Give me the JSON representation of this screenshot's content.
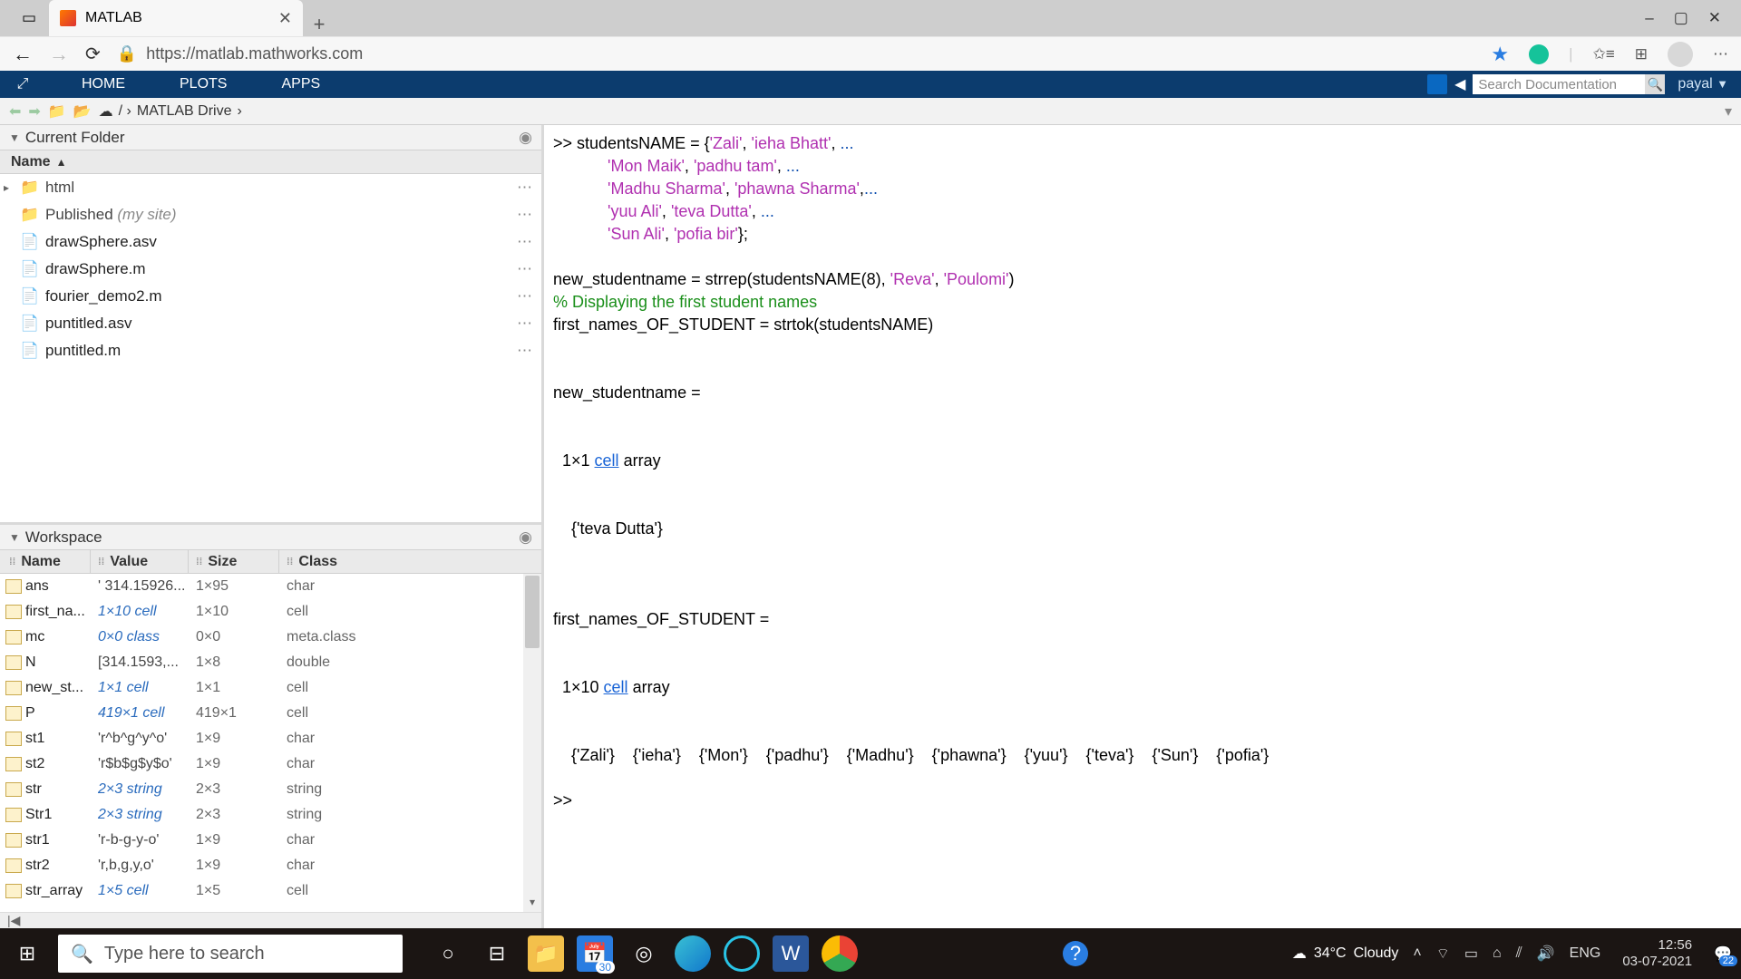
{
  "browser": {
    "tab_title": "MATLAB",
    "url": "https://matlab.mathworks.com",
    "window_minimize": "–",
    "window_maximize": "▢",
    "window_close": "✕"
  },
  "toolstrip": {
    "tabs": [
      "HOME",
      "PLOTS",
      "APPS"
    ],
    "search_placeholder": "Search Documentation",
    "user": "payal"
  },
  "pathbar": {
    "root": "MATLAB Drive"
  },
  "current_folder": {
    "title": "Current Folder",
    "name_header": "Name",
    "items": [
      {
        "name": "html",
        "type": "folder",
        "exp": true
      },
      {
        "name": "Published",
        "suffix": "(my site)",
        "type": "folder"
      },
      {
        "name": "drawSphere.asv",
        "type": "file"
      },
      {
        "name": "drawSphere.m",
        "type": "mfile"
      },
      {
        "name": "fourier_demo2.m",
        "type": "mfile"
      },
      {
        "name": "puntitled.asv",
        "type": "file"
      },
      {
        "name": "puntitled.m",
        "type": "mfile"
      }
    ]
  },
  "workspace": {
    "title": "Workspace",
    "cols": {
      "name": "Name",
      "value": "Value",
      "size": "Size",
      "class": "Class"
    },
    "rows": [
      {
        "name": "ans",
        "value": "' 314.15926...",
        "size": "1×95",
        "class": "char",
        "vstyle": "plain"
      },
      {
        "name": "first_na...",
        "value": "1×10 cell",
        "size": "1×10",
        "class": "cell"
      },
      {
        "name": "mc",
        "value": "0×0 class",
        "size": "0×0",
        "class": "meta.class"
      },
      {
        "name": "N",
        "value": "[314.1593,...",
        "size": "1×8",
        "class": "double",
        "vstyle": "plain"
      },
      {
        "name": "new_st...",
        "value": "1×1 cell",
        "size": "1×1",
        "class": "cell"
      },
      {
        "name": "P",
        "value": "419×1 cell",
        "size": "419×1",
        "class": "cell"
      },
      {
        "name": "st1",
        "value": "'r^b^g^y^o'",
        "size": "1×9",
        "class": "char",
        "vstyle": "plain"
      },
      {
        "name": "st2",
        "value": "'r$b$g$y$o'",
        "size": "1×9",
        "class": "char",
        "vstyle": "plain"
      },
      {
        "name": "str",
        "value": "2×3 string",
        "size": "2×3",
        "class": "string"
      },
      {
        "name": "Str1",
        "value": "2×3 string",
        "size": "2×3",
        "class": "string"
      },
      {
        "name": "str1",
        "value": "'r-b-g-y-o'",
        "size": "1×9",
        "class": "char",
        "vstyle": "plain"
      },
      {
        "name": "str2",
        "value": "'r,b,g,y,o'",
        "size": "1×9",
        "class": "char",
        "vstyle": "plain"
      },
      {
        "name": "str_array",
        "value": "1×5 cell",
        "size": "1×5",
        "class": "cell"
      }
    ]
  },
  "command_window": {
    "lines": [
      {
        "segs": [
          {
            "t": ">> studentsNAME = {"
          },
          {
            "t": "'Zali'",
            "c": "str"
          },
          {
            "t": ", "
          },
          {
            "t": "'ieha Bhatt'",
            "c": "str"
          },
          {
            "t": ", "
          },
          {
            "t": "...",
            "c": "kw"
          }
        ]
      },
      {
        "segs": [
          {
            "t": "            "
          },
          {
            "t": "'Mon Maik'",
            "c": "str"
          },
          {
            "t": ", "
          },
          {
            "t": "'padhu tam'",
            "c": "str"
          },
          {
            "t": ", "
          },
          {
            "t": "...",
            "c": "kw"
          }
        ]
      },
      {
        "segs": [
          {
            "t": "            "
          },
          {
            "t": "'Madhu Sharma'",
            "c": "str"
          },
          {
            "t": ", "
          },
          {
            "t": "'phawna Sharma'",
            "c": "str"
          },
          {
            "t": ","
          },
          {
            "t": "...",
            "c": "kw"
          }
        ]
      },
      {
        "segs": [
          {
            "t": "            "
          },
          {
            "t": "'yuu Ali'",
            "c": "str"
          },
          {
            "t": ", "
          },
          {
            "t": "'teva Dutta'",
            "c": "str"
          },
          {
            "t": ", "
          },
          {
            "t": "...",
            "c": "kw"
          }
        ]
      },
      {
        "segs": [
          {
            "t": "            "
          },
          {
            "t": "'Sun Ali'",
            "c": "str"
          },
          {
            "t": ", "
          },
          {
            "t": "'pofia bir'",
            "c": "str"
          },
          {
            "t": "};"
          }
        ]
      },
      {
        "segs": [
          {
            "t": ""
          }
        ]
      },
      {
        "segs": [
          {
            "t": "new_studentname = strrep(studentsNAME(8), "
          },
          {
            "t": "'Reva'",
            "c": "str"
          },
          {
            "t": ", "
          },
          {
            "t": "'Poulomi'",
            "c": "str"
          },
          {
            "t": ")"
          }
        ]
      },
      {
        "segs": [
          {
            "t": "% Displaying the first student names",
            "c": "cmt"
          }
        ]
      },
      {
        "segs": [
          {
            "t": "first_names_OF_STUDENT = strtok(studentsNAME)"
          }
        ]
      },
      {
        "segs": [
          {
            "t": ""
          }
        ]
      },
      {
        "segs": [
          {
            "t": ""
          }
        ]
      },
      {
        "segs": [
          {
            "t": "new_studentname ="
          }
        ]
      },
      {
        "segs": [
          {
            "t": ""
          }
        ]
      },
      {
        "segs": [
          {
            "t": ""
          }
        ]
      },
      {
        "segs": [
          {
            "t": "  1×1 "
          },
          {
            "t": "cell",
            "c": "lnk"
          },
          {
            "t": " array"
          }
        ]
      },
      {
        "segs": [
          {
            "t": ""
          }
        ]
      },
      {
        "segs": [
          {
            "t": ""
          }
        ]
      },
      {
        "segs": [
          {
            "t": "    {'teva Dutta'}"
          }
        ]
      },
      {
        "segs": [
          {
            "t": ""
          }
        ]
      },
      {
        "segs": [
          {
            "t": ""
          }
        ]
      },
      {
        "segs": [
          {
            "t": ""
          }
        ]
      },
      {
        "segs": [
          {
            "t": "first_names_OF_STUDENT ="
          }
        ]
      },
      {
        "segs": [
          {
            "t": ""
          }
        ]
      },
      {
        "segs": [
          {
            "t": ""
          }
        ]
      },
      {
        "segs": [
          {
            "t": "  1×10 "
          },
          {
            "t": "cell",
            "c": "lnk"
          },
          {
            "t": " array"
          }
        ]
      },
      {
        "segs": [
          {
            "t": ""
          }
        ]
      },
      {
        "segs": [
          {
            "t": ""
          }
        ]
      },
      {
        "segs": [
          {
            "t": "    {'Zali'}    {'ieha'}    {'Mon'}    {'padhu'}    {'Madhu'}    {'phawna'}    {'yuu'}    {'teva'}    {'Sun'}    {'pofia'}"
          }
        ]
      },
      {
        "segs": [
          {
            "t": ""
          }
        ]
      },
      {
        "segs": [
          {
            "t": ">> "
          }
        ]
      }
    ]
  },
  "taskbar": {
    "search_placeholder": "Type here to search",
    "weather_temp": "34°C",
    "weather_desc": "Cloudy",
    "lang": "ENG",
    "time": "12:56",
    "date": "03-07-2021",
    "calendar_badge": "30",
    "notif_badge": "22"
  }
}
